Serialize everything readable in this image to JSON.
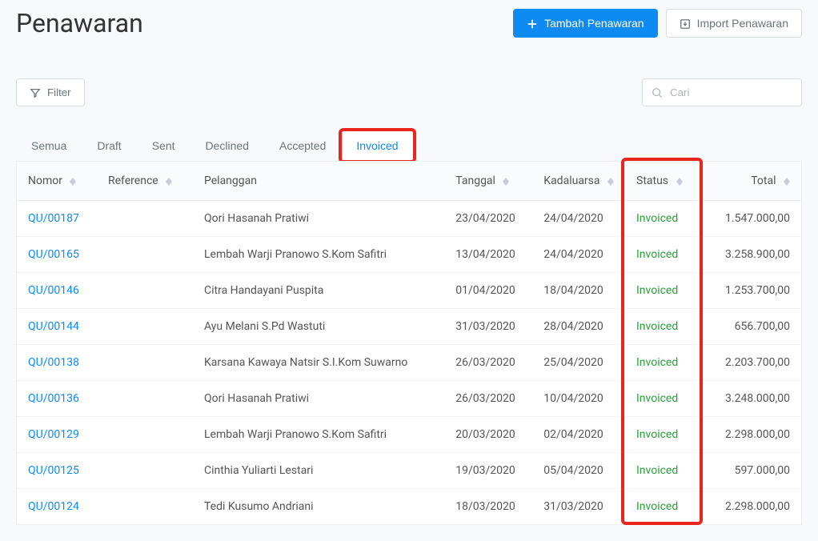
{
  "page": {
    "title": "Penawaran"
  },
  "actions": {
    "add": "Tambah Penawaran",
    "import": "Import Penawaran"
  },
  "toolbar": {
    "filter": "Filter",
    "search_placeholder": "Cari"
  },
  "tabs": [
    {
      "label": "Semua",
      "active": false
    },
    {
      "label": "Draft",
      "active": false
    },
    {
      "label": "Sent",
      "active": false
    },
    {
      "label": "Declined",
      "active": false
    },
    {
      "label": "Accepted",
      "active": false
    },
    {
      "label": "Invoiced",
      "active": true
    }
  ],
  "columns": {
    "nomor": "Nomor",
    "reference": "Reference",
    "pelanggan": "Pelanggan",
    "tanggal": "Tanggal",
    "kadaluarsa": "Kadaluarsa",
    "status": "Status",
    "total": "Total"
  },
  "rows": [
    {
      "nomor": "QU/00187",
      "reference": "",
      "pelanggan": "Qori Hasanah Pratiwi",
      "tanggal": "23/04/2020",
      "kadaluarsa": "24/04/2020",
      "status": "Invoiced",
      "total": "1.547.000,00"
    },
    {
      "nomor": "QU/00165",
      "reference": "",
      "pelanggan": "Lembah Warji Pranowo S.Kom Safitri",
      "tanggal": "13/04/2020",
      "kadaluarsa": "24/04/2020",
      "status": "Invoiced",
      "total": "3.258.900,00"
    },
    {
      "nomor": "QU/00146",
      "reference": "",
      "pelanggan": "Citra Handayani Puspita",
      "tanggal": "01/04/2020",
      "kadaluarsa": "18/04/2020",
      "status": "Invoiced",
      "total": "1.253.700,00"
    },
    {
      "nomor": "QU/00144",
      "reference": "",
      "pelanggan": "Ayu Melani S.Pd Wastuti",
      "tanggal": "31/03/2020",
      "kadaluarsa": "28/04/2020",
      "status": "Invoiced",
      "total": "656.700,00"
    },
    {
      "nomor": "QU/00138",
      "reference": "",
      "pelanggan": "Karsana Kawaya Natsir S.I.Kom Suwarno",
      "tanggal": "26/03/2020",
      "kadaluarsa": "25/04/2020",
      "status": "Invoiced",
      "total": "2.203.700,00"
    },
    {
      "nomor": "QU/00136",
      "reference": "",
      "pelanggan": "Qori Hasanah Pratiwi",
      "tanggal": "26/03/2020",
      "kadaluarsa": "10/04/2020",
      "status": "Invoiced",
      "total": "3.248.000,00"
    },
    {
      "nomor": "QU/00129",
      "reference": "",
      "pelanggan": "Lembah Warji Pranowo S.Kom Safitri",
      "tanggal": "20/03/2020",
      "kadaluarsa": "02/04/2020",
      "status": "Invoiced",
      "total": "2.298.000,00"
    },
    {
      "nomor": "QU/00125",
      "reference": "",
      "pelanggan": "Cinthia Yuliarti Lestari",
      "tanggal": "19/03/2020",
      "kadaluarsa": "05/04/2020",
      "status": "Invoiced",
      "total": "597.000,00"
    },
    {
      "nomor": "QU/00124",
      "reference": "",
      "pelanggan": "Tedi Kusumo Andriani",
      "tanggal": "18/03/2020",
      "kadaluarsa": "31/03/2020",
      "status": "Invoiced",
      "total": "2.298.000,00"
    }
  ]
}
